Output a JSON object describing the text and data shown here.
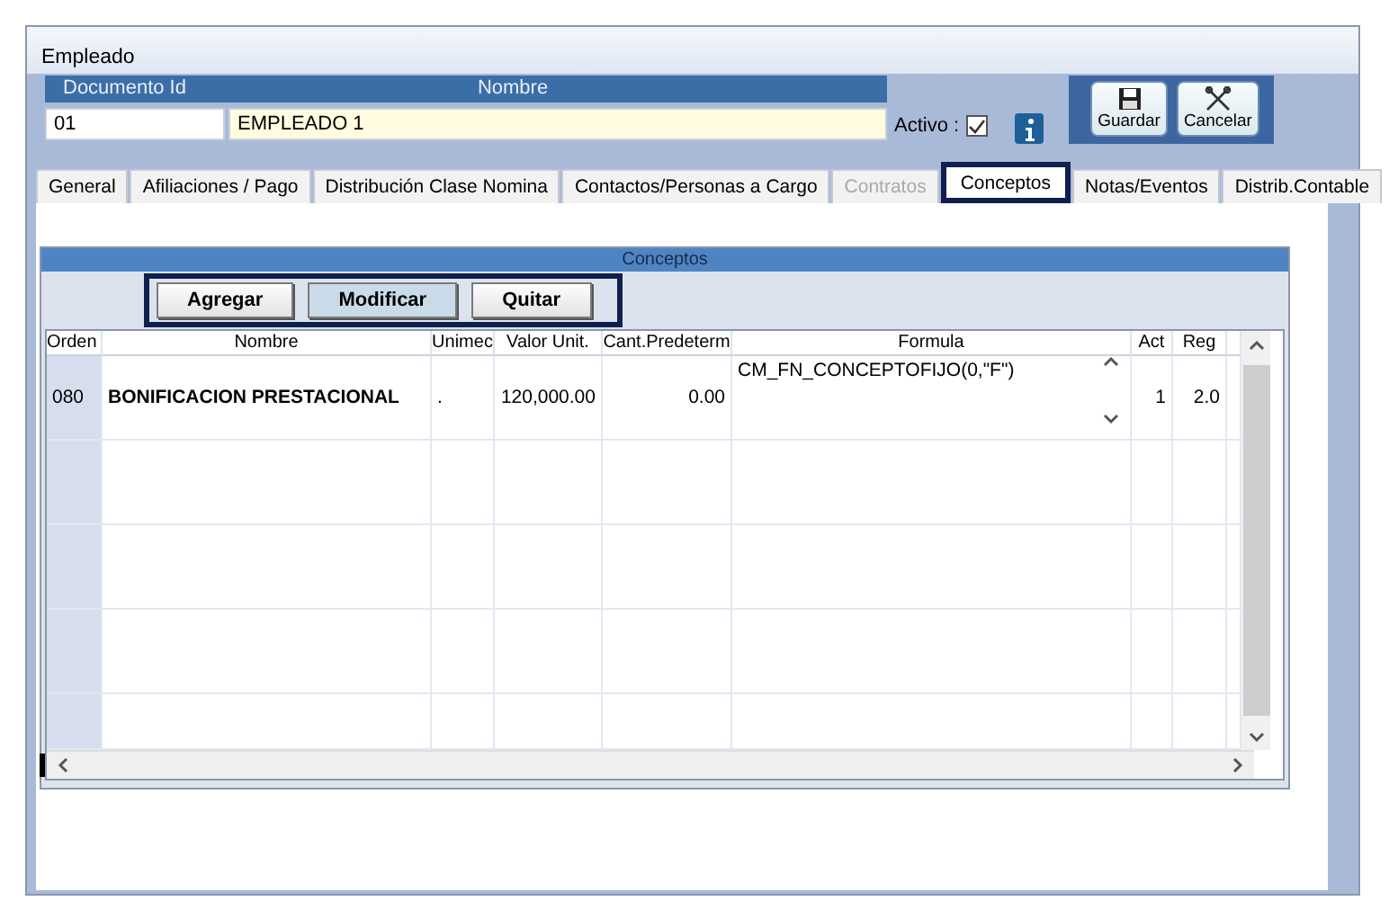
{
  "window": {
    "title": "Empleado"
  },
  "header": {
    "fields": [
      {
        "label": "Documento Id",
        "value": "01"
      },
      {
        "label": "Nombre",
        "value": "EMPLEADO 1"
      }
    ],
    "activo": {
      "label": "Activo :",
      "checked": true
    }
  },
  "actions": [
    {
      "label": "Guardar",
      "kind": "save"
    },
    {
      "label": "Cancelar",
      "kind": "cancel"
    }
  ],
  "tabs": [
    {
      "label": "General",
      "selected": false,
      "disabled": false
    },
    {
      "label": "Afiliaciones / Pago",
      "selected": false,
      "disabled": false
    },
    {
      "label": "Distribución Clase Nomina",
      "selected": false,
      "disabled": false
    },
    {
      "label": "Contactos/Personas a Cargo",
      "selected": false,
      "disabled": false
    },
    {
      "label": "Contratos",
      "selected": false,
      "disabled": true
    },
    {
      "label": "Conceptos",
      "selected": true,
      "disabled": false
    },
    {
      "label": "Notas/Eventos",
      "selected": false,
      "disabled": false
    },
    {
      "label": "Distrib.Contable",
      "selected": false,
      "disabled": false
    }
  ],
  "panel": {
    "title": "Conceptos",
    "buttons": [
      {
        "label": "Agregar",
        "selected": false
      },
      {
        "label": "Modificar",
        "selected": true
      },
      {
        "label": "Quitar",
        "selected": false
      }
    ],
    "table": {
      "columns": [
        "Orden",
        "Nombre",
        "Unimec",
        "Valor Unit.",
        "Cant.Predeterm",
        "Formula",
        "Act",
        "Reg"
      ],
      "rows": [
        [
          "080",
          "BONIFICACION PRESTACIONAL",
          ".",
          "120,000.00",
          "0.00",
          "CM_FN_CONCEPTOFIJO(0,\"F\")",
          "1",
          "2.0"
        ]
      ]
    }
  }
}
